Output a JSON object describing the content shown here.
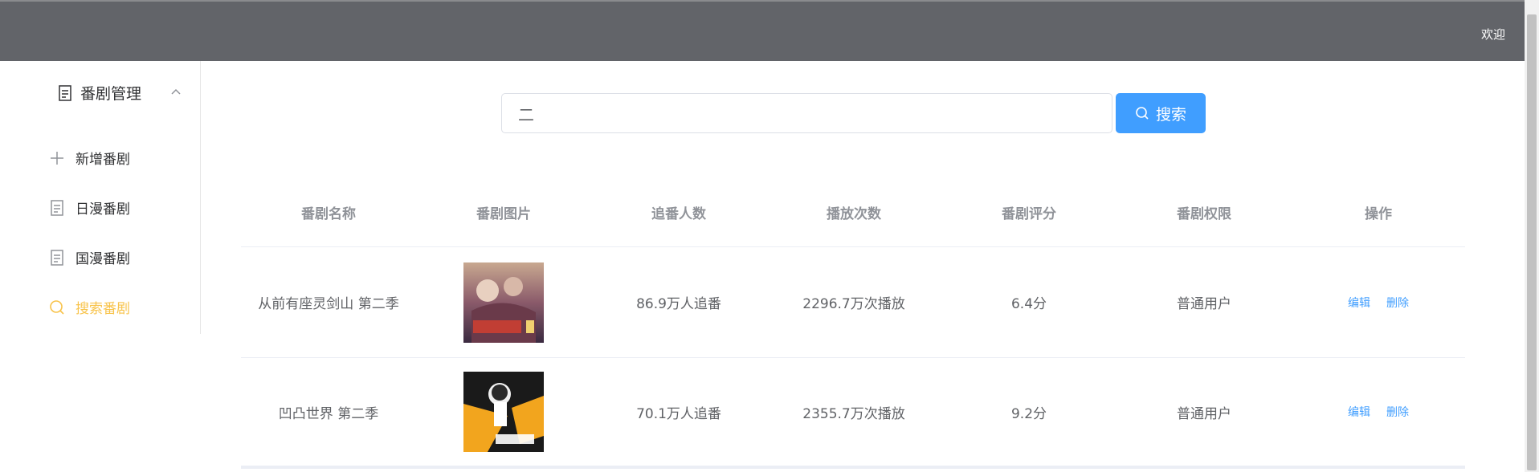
{
  "header": {
    "welcome": "欢迎"
  },
  "sidebar": {
    "submenu_title": "番剧管理",
    "items": [
      {
        "label": "新增番剧",
        "icon": "plus-icon",
        "active": false
      },
      {
        "label": "日漫番剧",
        "icon": "document-icon",
        "active": false
      },
      {
        "label": "国漫番剧",
        "icon": "document-icon",
        "active": false
      },
      {
        "label": "搜索番剧",
        "icon": "search-icon",
        "active": true
      }
    ]
  },
  "search": {
    "value": "二",
    "button_label": "搜索"
  },
  "table": {
    "headers": [
      "番剧名称",
      "番剧图片",
      "追番人数",
      "播放次数",
      "番剧评分",
      "番剧权限",
      "操作"
    ],
    "rows": [
      {
        "name": "从前有座灵剑山 第二季",
        "followers": "86.9万人追番",
        "plays": "2296.7万次播放",
        "score": "6.4分",
        "permission": "普通用户",
        "edit": "编辑",
        "delete": "删除"
      },
      {
        "name": "凹凸世界 第二季",
        "followers": "70.1万人追番",
        "plays": "2355.7万次播放",
        "score": "9.2分",
        "permission": "普通用户",
        "edit": "编辑",
        "delete": "删除"
      }
    ]
  },
  "colors": {
    "header_bg": "#626469",
    "primary": "#409eff",
    "active_menu": "#f8c34a"
  }
}
